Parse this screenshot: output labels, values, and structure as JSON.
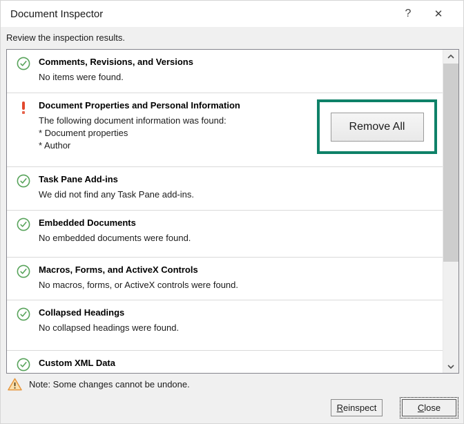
{
  "titlebar": {
    "title": "Document Inspector",
    "help_glyph": "?",
    "close_glyph": "✕"
  },
  "subtitle": "Review the inspection results.",
  "sections": [
    {
      "icon": "check-circle",
      "title": "Comments, Revisions, and Versions",
      "lines": [
        "No items were found."
      ]
    },
    {
      "icon": "exclamation",
      "title": "Document Properties and Personal Information",
      "lines": [
        "The following document information was found:",
        "* Document properties",
        "* Author"
      ],
      "button": "Remove All",
      "highlighted": true
    },
    {
      "icon": "check-circle",
      "title": "Task Pane Add-ins",
      "lines": [
        "We did not find any Task Pane add-ins."
      ]
    },
    {
      "icon": "check-circle",
      "title": "Embedded Documents",
      "lines": [
        "No embedded documents were found."
      ]
    },
    {
      "icon": "check-circle",
      "title": "Macros, Forms, and ActiveX Controls",
      "lines": [
        "No macros, forms, or ActiveX controls were found."
      ]
    },
    {
      "icon": "check-circle",
      "title": "Collapsed Headings",
      "lines": [
        "No collapsed headings were found."
      ]
    },
    {
      "icon": "check-circle",
      "title": "Custom XML Data",
      "lines": []
    }
  ],
  "footer": {
    "note": "Note: Some changes cannot be undone.",
    "reinspect_underlined": "R",
    "reinspect_rest": "einspect",
    "close_underlined": "C",
    "close_rest": "lose"
  },
  "colors": {
    "highlight_annotation": "#0e8168",
    "check_green": "#57a35a",
    "exclamation_red": "#e2492e",
    "warning_orange": "#e6973e",
    "scrollbar_thumb": "#cdcdcd"
  }
}
